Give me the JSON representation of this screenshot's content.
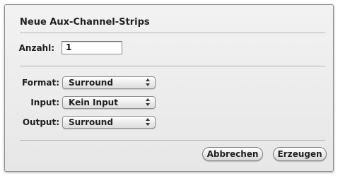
{
  "dialog": {
    "title": "Neue Aux-Channel-Strips",
    "count_label": "Anzahl:",
    "count_value": "1",
    "fields": [
      {
        "label": "Format:",
        "value": "Surround"
      },
      {
        "label": "Input:",
        "value": "Kein Input"
      },
      {
        "label": "Output:",
        "value": "Surround"
      }
    ],
    "buttons": {
      "cancel_label": "Abbrechen",
      "create_label": "Erzeugen"
    }
  }
}
